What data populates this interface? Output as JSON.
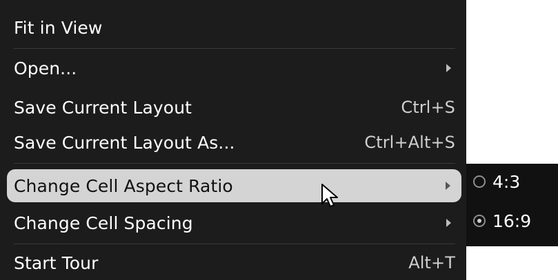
{
  "menu": {
    "items": [
      {
        "label": "Fit in View",
        "shortcut": ""
      },
      {
        "label": "Open...",
        "shortcut": ""
      },
      {
        "label": "Save Current Layout",
        "shortcut": "Ctrl+S"
      },
      {
        "label": "Save Current Layout As...",
        "shortcut": "Ctrl+Alt+S"
      },
      {
        "label": "Change Cell Aspect Ratio",
        "shortcut": ""
      },
      {
        "label": "Change Cell Spacing",
        "shortcut": ""
      },
      {
        "label": "Start Tour",
        "shortcut": "Alt+T"
      }
    ]
  },
  "submenu": {
    "options": [
      {
        "label": "4:3",
        "selected": false
      },
      {
        "label": "16:9",
        "selected": true
      }
    ]
  },
  "colors": {
    "menu_bg": "#1c1c1c",
    "highlight_bg": "#d4d4d4",
    "text": "#ffffff",
    "separator": "#3a3a3a"
  },
  "icons": [
    "submenu-arrow-icon",
    "mouse-cursor-icon",
    "radio-icon"
  ]
}
